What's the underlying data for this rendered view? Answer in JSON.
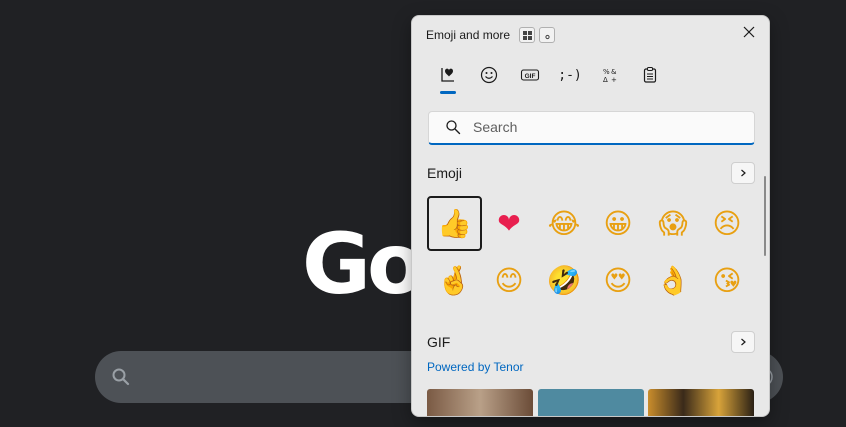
{
  "background": {
    "logo_text": "Go"
  },
  "panel": {
    "title": "Emoji and more",
    "tabs": [
      {
        "icon": "heart-icon",
        "label": "Recent"
      },
      {
        "icon": "smiley-icon",
        "label": "Emoji"
      },
      {
        "icon": "gif-icon",
        "label": "GIF"
      },
      {
        "icon": "kaomoji-icon",
        "label": ";-)"
      },
      {
        "icon": "symbols-icon",
        "label": "Symbols"
      },
      {
        "icon": "clipboard-icon",
        "label": "Clipboard"
      }
    ],
    "search": {
      "placeholder": "Search",
      "value": ""
    },
    "emoji_section": {
      "title": "Emoji"
    },
    "emojis": [
      "👍",
      "❤",
      "😂",
      "😀",
      "😱",
      "😣",
      "🤞",
      "😊",
      "🤣",
      "😍",
      "👌",
      "😘"
    ],
    "gif_section": {
      "title": "GIF",
      "powered_by": "Powered by Tenor"
    },
    "colors": {
      "accent": "#0067c0",
      "panel_bg": "#e8e8e8",
      "page_bg": "#202124",
      "search_pill": "#4d5156"
    }
  }
}
